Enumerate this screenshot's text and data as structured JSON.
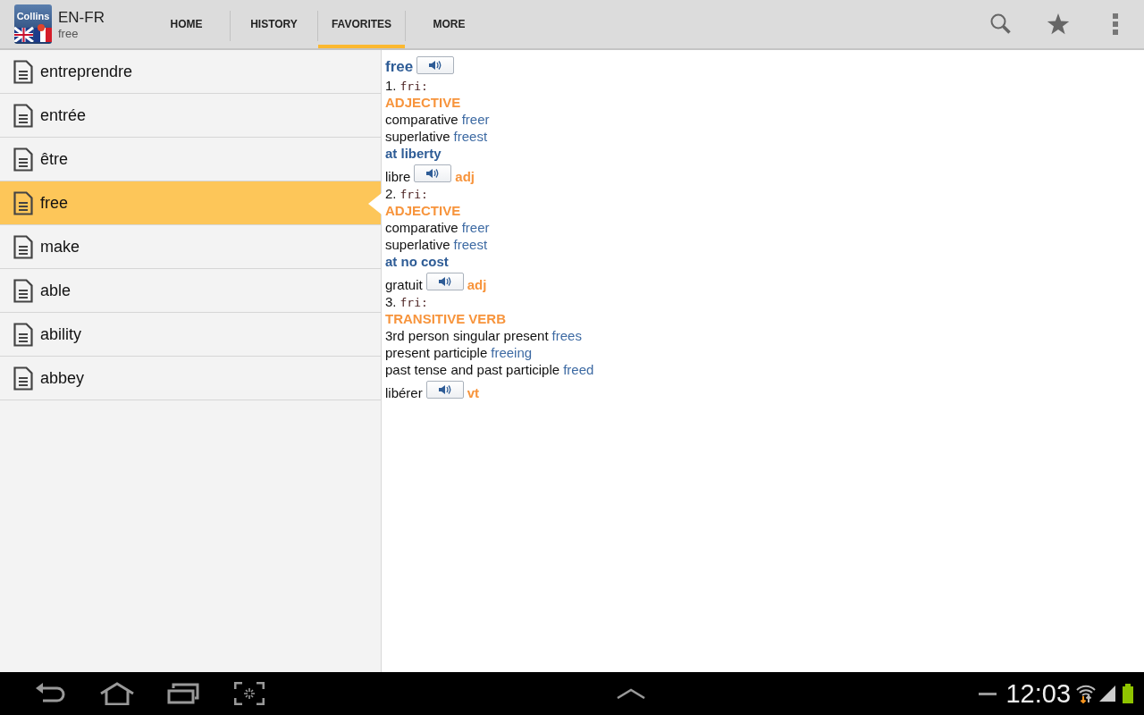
{
  "app": {
    "logo_text": "Collins",
    "title": "EN-FR",
    "subtitle": "free"
  },
  "tabs": [
    {
      "label": "HOME",
      "selected": false
    },
    {
      "label": "HISTORY",
      "selected": false
    },
    {
      "label": "FAVORITES",
      "selected": true
    },
    {
      "label": "MORE",
      "selected": false
    }
  ],
  "words": [
    {
      "label": "entreprendre",
      "selected": false
    },
    {
      "label": "entrée",
      "selected": false
    },
    {
      "label": "être",
      "selected": false
    },
    {
      "label": "free",
      "selected": true
    },
    {
      "label": "make",
      "selected": false
    },
    {
      "label": "able",
      "selected": false
    },
    {
      "label": "ability",
      "selected": false
    },
    {
      "label": "abbey",
      "selected": false
    }
  ],
  "entry": [
    {
      "kind": "headword",
      "text": "free"
    },
    {
      "kind": "sense",
      "number": "1.",
      "pron": "fri:"
    },
    {
      "kind": "pos",
      "text": "ADJECTIVE"
    },
    {
      "kind": "form",
      "label": "comparative",
      "value": "freer"
    },
    {
      "kind": "form",
      "label": "superlative",
      "value": "freest"
    },
    {
      "kind": "meaning",
      "text": "at liberty"
    },
    {
      "kind": "translation",
      "word": "libre",
      "pos": "adj"
    },
    {
      "kind": "sense",
      "number": "2.",
      "pron": "fri:"
    },
    {
      "kind": "pos",
      "text": "ADJECTIVE"
    },
    {
      "kind": "form",
      "label": "comparative",
      "value": "freer"
    },
    {
      "kind": "form",
      "label": "superlative",
      "value": "freest"
    },
    {
      "kind": "meaning",
      "text": "at no cost"
    },
    {
      "kind": "translation",
      "word": "gratuit",
      "pos": "adj"
    },
    {
      "kind": "sense",
      "number": "3.",
      "pron": "fri:"
    },
    {
      "kind": "pos",
      "text": "TRANSITIVE VERB"
    },
    {
      "kind": "form",
      "label": "3rd person singular present",
      "value": "frees"
    },
    {
      "kind": "form",
      "label": "present participle",
      "value": "freeing"
    },
    {
      "kind": "form",
      "label": "past tense and past participle",
      "value": "freed"
    },
    {
      "kind": "translation",
      "word": "libérer",
      "pos": "vt"
    }
  ],
  "status_bar": {
    "time": "12:03"
  }
}
